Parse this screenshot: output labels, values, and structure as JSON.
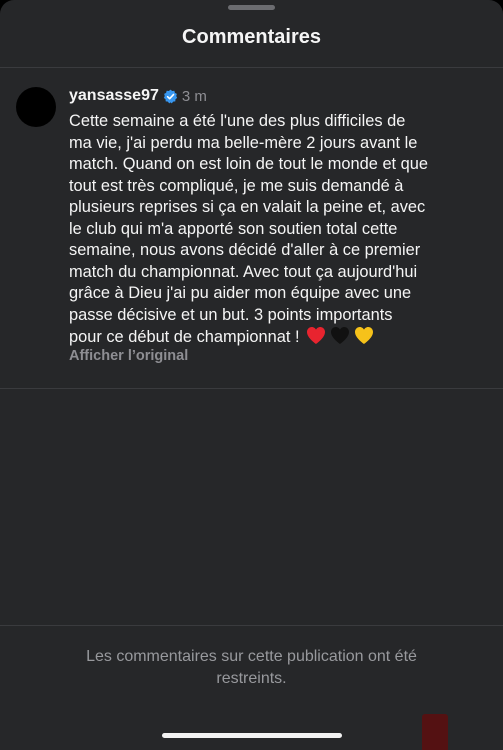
{
  "sheet": {
    "title": "Commentaires"
  },
  "comment": {
    "username": "yansasse97",
    "verified": true,
    "time": "3 m",
    "text": "Cette semaine a été l'une des plus difficiles de\nma vie, j'ai perdu ma belle-mère 2 jours avant le\nmatch. Quand on est loin de tout le monde et que\ntout est très compliqué, je me suis demandé à\nplusieurs reprises si ça en valait la peine et, avec\nle club qui m'a apporté son soutien total cette\nsemaine, nous avons décidé d'aller à ce premier\nmatch du championnat. Avec tout ça aujourd'hui\ngrâce à Dieu j'ai pu aider mon équipe avec une\npasse décisive et un but. 3 points importants\npour ce début de championnat !",
    "emojis": [
      "red-heart",
      "black-heart",
      "yellow-heart"
    ],
    "show_original_label": "Afficher l’original"
  },
  "footer": {
    "restricted_text": "Les commentaires sur cette publication ont été\nrestreints."
  },
  "colors": {
    "background": "#262729",
    "text": "#f5f5f5",
    "muted": "#8e8e93",
    "verified_badge": "#3897f0"
  }
}
